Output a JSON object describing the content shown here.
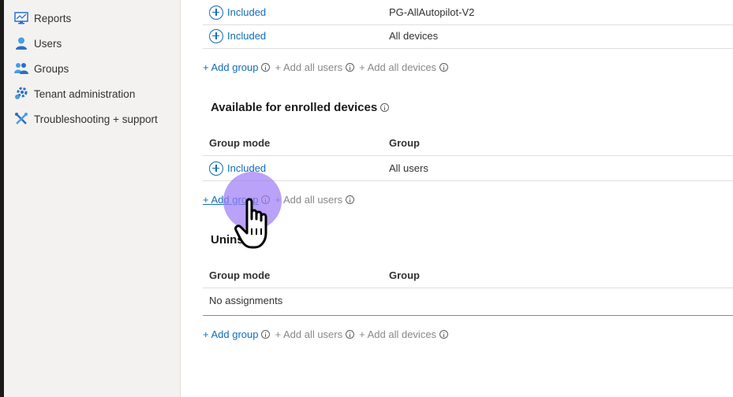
{
  "sidebar": {
    "items": [
      {
        "label": "Reports",
        "icon": "reports-icon"
      },
      {
        "label": "Users",
        "icon": "users-icon"
      },
      {
        "label": "Groups",
        "icon": "groups-icon"
      },
      {
        "label": "Tenant administration",
        "icon": "tenant-admin-icon"
      },
      {
        "label": "Troubleshooting + support",
        "icon": "troubleshooting-icon"
      }
    ]
  },
  "required": {
    "rows": [
      {
        "mode": "Included",
        "group": "PG-AllAutopilot-V2"
      },
      {
        "mode": "Included",
        "group": "All devices"
      }
    ],
    "actions": {
      "add_group": "+ Add group",
      "add_all_users": "+ Add all users",
      "add_all_devices": "+ Add all devices"
    }
  },
  "available": {
    "title": "Available for enrolled devices",
    "headers": {
      "mode": "Group mode",
      "group": "Group"
    },
    "rows": [
      {
        "mode": "Included",
        "group": "All users"
      }
    ],
    "actions": {
      "add_group": "+ Add group",
      "add_all_users": "+ Add all users"
    }
  },
  "uninstall": {
    "title": "Uninstall",
    "headers": {
      "mode": "Group mode",
      "group": "Group"
    },
    "empty": "No assignments",
    "actions": {
      "add_group": "+ Add group",
      "add_all_users": "+ Add all users",
      "add_all_devices": "+ Add all devices"
    }
  },
  "colors": {
    "accent": "#0f6cbd",
    "disabled": "#8a8886",
    "cursor_highlight": "#9b7bf5"
  }
}
